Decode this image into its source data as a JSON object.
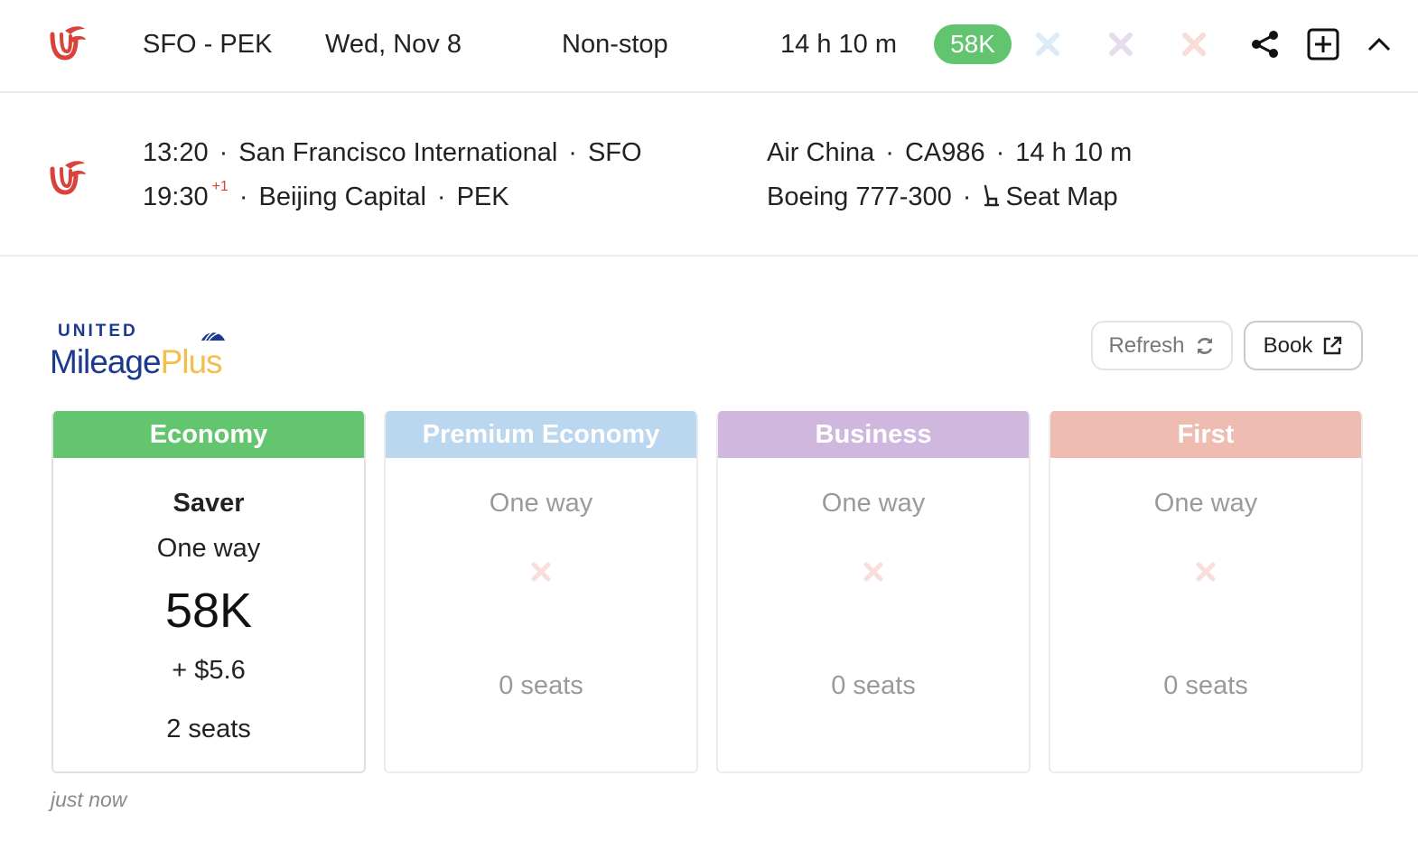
{
  "summary": {
    "airline_logo": "air-china-logo",
    "route": "SFO - PEK",
    "date": "Wed, Nov 8",
    "stops": "Non-stop",
    "duration": "14 h 10 m",
    "best_price": "58K",
    "icons": [
      "premium-unavailable-icon",
      "business-unavailable-icon",
      "first-unavailable-icon",
      "share-icon",
      "add-box-icon",
      "chevron-up-icon"
    ]
  },
  "segment": {
    "depart_time": "13:20",
    "depart_airport": "San Francisco International",
    "depart_code": "SFO",
    "arrive_time": "19:30",
    "arrive_day_offset": "+1",
    "arrive_airport": "Beijing Capital",
    "arrive_code": "PEK",
    "airline": "Air China",
    "flight_number": "CA986",
    "duration": "14 h 10 m",
    "aircraft": "Boeing 777-300",
    "seat_map_label": "Seat Map",
    "separator": "·"
  },
  "program": {
    "logo_top": "UNITED",
    "logo_part1": "Mileage",
    "logo_part2": "Plus",
    "refresh_label": "Refresh",
    "book_label": "Book"
  },
  "cabins": {
    "economy": {
      "name": "Economy",
      "fare_type": "Saver",
      "trip": "One way",
      "miles": "58K",
      "fees": "+ $5.6",
      "seats": "2 seats",
      "color": "#63c66f"
    },
    "premium_economy": {
      "name": "Premium Economy",
      "trip": "One way",
      "seats": "0 seats",
      "color": "#bad7ef"
    },
    "business": {
      "name": "Business",
      "trip": "One way",
      "seats": "0 seats",
      "color": "#d0b7de"
    },
    "first": {
      "name": "First",
      "trip": "One way",
      "seats": "0 seats",
      "color": "#efbcb2"
    }
  },
  "updated": "just now"
}
